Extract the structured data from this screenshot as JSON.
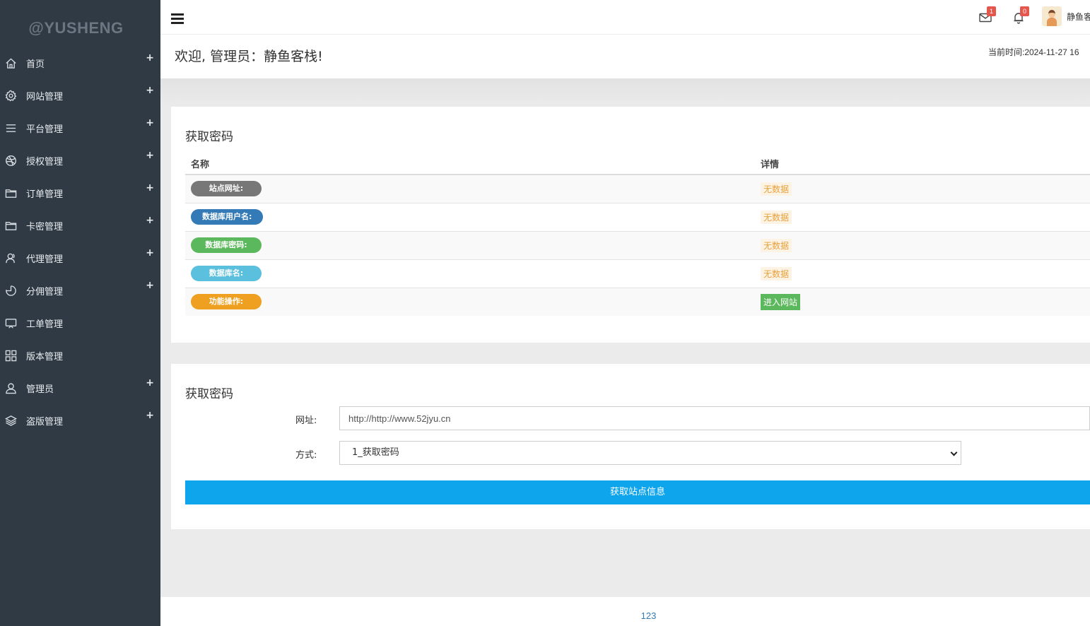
{
  "brand": "@YUSHENG",
  "sidebar": {
    "items": [
      {
        "label": "首页",
        "icon": "home-icon",
        "expandable": true
      },
      {
        "label": "网站管理",
        "icon": "gear-icon",
        "expandable": true
      },
      {
        "label": "平台管理",
        "icon": "list-icon",
        "expandable": true
      },
      {
        "label": "授权管理",
        "icon": "dribbble-icon",
        "expandable": true
      },
      {
        "label": "订单管理",
        "icon": "folder-icon",
        "expandable": true
      },
      {
        "label": "卡密管理",
        "icon": "folder-icon",
        "expandable": true
      },
      {
        "label": "代理管理",
        "icon": "user-group-icon",
        "expandable": true
      },
      {
        "label": "分佣管理",
        "icon": "pie-icon",
        "expandable": true
      },
      {
        "label": "工单管理",
        "icon": "screen-icon",
        "expandable": false
      },
      {
        "label": "版本管理",
        "icon": "grid-icon",
        "expandable": false
      },
      {
        "label": "管理员",
        "icon": "user-icon",
        "expandable": true
      },
      {
        "label": "盗版管理",
        "icon": "layers-icon",
        "expandable": true
      }
    ],
    "expand_symbol": "+"
  },
  "header": {
    "mail_badge": "1",
    "bell_badge": "0",
    "username": "静鱼客栈"
  },
  "welcome": {
    "title": "欢迎, 管理员：静鱼客栈!",
    "current_time": "当前时间:2024-11-27 16"
  },
  "panel1": {
    "title": "获取密码",
    "columns": [
      "名称",
      "详情"
    ],
    "rows": [
      {
        "name": "站点网址:",
        "color": "#777777",
        "detail": "无数据",
        "detail_type": "nodata"
      },
      {
        "name": "数据库用户名:",
        "color": "#337ab7",
        "detail": "无数据",
        "detail_type": "nodata"
      },
      {
        "name": "数据库密码:",
        "color": "#5cb85c",
        "detail": "无数据",
        "detail_type": "nodata"
      },
      {
        "name": "数据库名:",
        "color": "#5bc0de",
        "detail": "无数据",
        "detail_type": "nodata"
      },
      {
        "name": "功能操作:",
        "color": "#f0a020",
        "detail": "进入网站",
        "detail_type": "button"
      }
    ]
  },
  "panel2": {
    "title": "获取密码",
    "url_label": "网址:",
    "url_value": "http://http://www.52jyu.cn",
    "method_label": "方式:",
    "method_selected": "1_获取密码",
    "submit_label": "获取站点信息"
  },
  "footer": {
    "text": "123"
  }
}
